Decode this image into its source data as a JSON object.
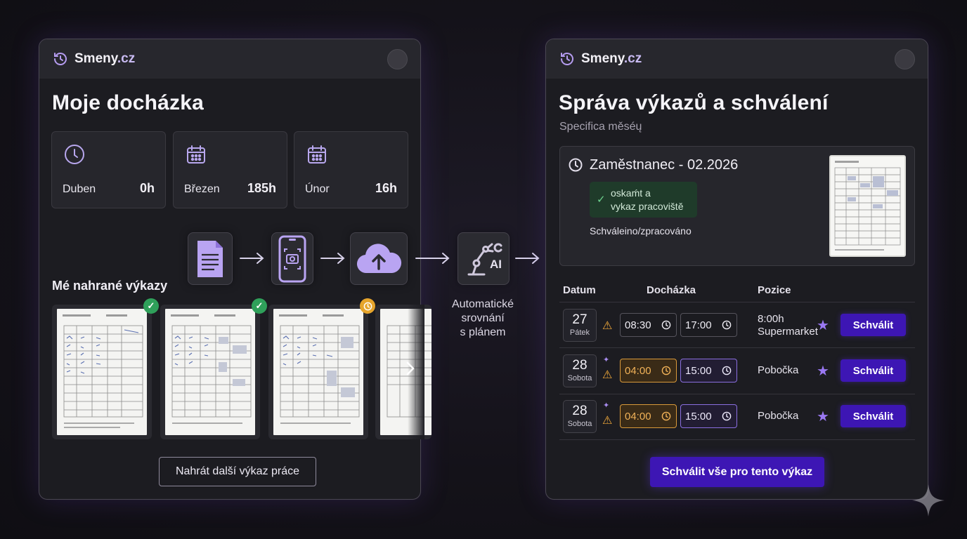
{
  "left": {
    "brand_name": "Smeny",
    "brand_tld": ".cz",
    "title": "Moje docházka",
    "stats": [
      {
        "label": "Duben",
        "value": "0h",
        "icon": "clock-icon"
      },
      {
        "label": "Březen",
        "value": "185h",
        "icon": "calendar-icon"
      },
      {
        "label": "Únor",
        "value": "16h",
        "icon": "calendar-icon"
      }
    ],
    "uploads_title": "Mé nahrané výkazy",
    "uploads": [
      {
        "status": "approved",
        "badge": "✓"
      },
      {
        "status": "approved",
        "badge": "✓"
      },
      {
        "status": "pending",
        "badge": "clock-icon"
      },
      {
        "status": "partial"
      }
    ],
    "upload_button": "Nahrát další výkaz práce"
  },
  "flow": {
    "steps": [
      "document-icon",
      "phone-scan-icon",
      "cloud-upload-icon",
      "ai-robot-icon"
    ],
    "ai_label": "AI",
    "caption_lines": [
      "Automatické",
      "srovnání",
      "s plánem"
    ]
  },
  "right": {
    "brand_name": "Smeny",
    "brand_tld": ".cz",
    "title": "Správa výkazů a schválení",
    "subtitle": "Specifica měséų",
    "employee": {
      "title": "Zaměstnanec - 02.2026",
      "status_lines": [
        "oskaḿt a",
        "vykaz pracoviště"
      ],
      "note": "Schváleino/zpracováno"
    },
    "table": {
      "headers": [
        "Datum",
        "Docházka",
        "Pozice"
      ],
      "rows": [
        {
          "day": "27",
          "weekday": "Pátek",
          "start": "08:30",
          "end": "17:00",
          "position_lines": [
            "8:00h",
            "Supermarket"
          ],
          "action": "Schválit",
          "highlight": "none"
        },
        {
          "day": "28",
          "weekday": "Sobota",
          "start": "04:00",
          "end": "15:00",
          "position_lines": [
            "Pobočka"
          ],
          "action": "Schválit",
          "highlight": "ai"
        },
        {
          "day": "28",
          "weekday": "Sobota",
          "start": "04:00",
          "end": "15:00",
          "position_lines": [
            "Pobočka"
          ],
          "action": "Schválit",
          "highlight": "ai"
        }
      ]
    },
    "approve_all": "Schválit vše pro tento výkaz"
  },
  "colors": {
    "accent": "#3d16b4",
    "approved": "#2fa05a",
    "pending": "#e6a52c",
    "warning": "#f1a93a",
    "star": "#9a78f2"
  }
}
